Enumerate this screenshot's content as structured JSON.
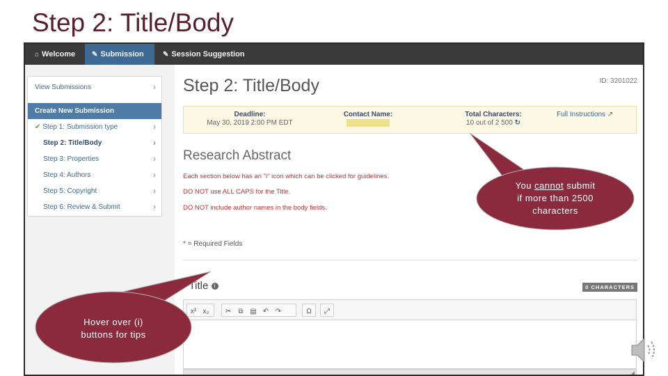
{
  "slide": {
    "title": "Step 2: Title/Body"
  },
  "navbar": {
    "tabs": [
      {
        "icon": "home-icon",
        "label": "Welcome"
      },
      {
        "icon": "pencil-icon",
        "label": "Submission"
      },
      {
        "icon": "pencil-icon",
        "label": "Session Suggestion"
      }
    ],
    "active_tab": "Submission"
  },
  "sidebar": {
    "view_submissions": "View Submissions",
    "header": "Create New Submission",
    "steps": [
      {
        "label": "Step 1: Submission type",
        "done": true
      },
      {
        "label": "Step 2: Title/Body",
        "current": true
      },
      {
        "label": "Step 3: Properties"
      },
      {
        "label": "Step 4: Authors"
      },
      {
        "label": "Step 5: Copyright"
      },
      {
        "label": "Step 6: Review & Submit"
      }
    ]
  },
  "main": {
    "id_text": "ID: 3201022",
    "heading": "Step 2: Title/Body",
    "info": {
      "deadline_label": "Deadline:",
      "deadline_value": "May 30, 2019 2:00 PM EDT",
      "contact_label": "Contact Name:",
      "chars_label": "Total Characters:",
      "chars_value": "10 out of 2 500",
      "full_instructions": "Full Instructions"
    },
    "abstract_heading": "Research Abstract",
    "notes": [
      "Each section below has an \"i\" icon which can be clicked for guidelines.",
      "DO NOT use ALL CAPS for the Title.",
      "DO NOT include author names in the body fields."
    ],
    "required_star": "*",
    "required_text": "= Required Fields",
    "title_star": "*",
    "title_label": "Title",
    "char_badge": "0 CHARACTERS"
  },
  "callouts": {
    "top_right": {
      "pre": "You ",
      "underlined": "cannot",
      "post": " submit",
      "line2": "if more than 2500",
      "line3": "characters"
    },
    "bottom_left": {
      "line1": "Hover over (i)",
      "line2": "buttons for tips"
    }
  },
  "colors": {
    "callout_fill": "#8b2a3c",
    "title_color": "#5a1f2c",
    "nav_active": "#3d6a95"
  }
}
